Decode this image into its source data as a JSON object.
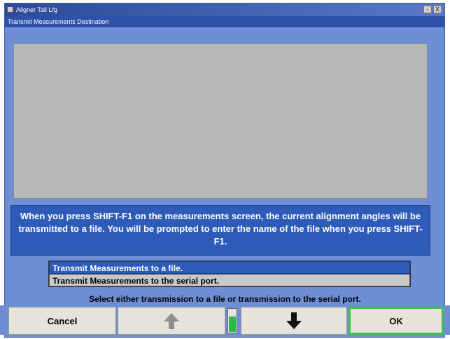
{
  "window": {
    "title": "Aligner Tail Lfg",
    "subtitle": "Transmit Measurements Destination",
    "controls": [
      "-",
      "X"
    ]
  },
  "message": {
    "text": "When you press SHIFT-F1 on the measurements screen, the current alignment angles will be transmitted to a file.  You will be prompted to enter the name of the file when you press SHIFT-F1."
  },
  "list": {
    "items": [
      {
        "label": "Transmit Measurements to a file.",
        "selected": true
      },
      {
        "label": "Transmit Measurements to the serial port.",
        "selected": false
      }
    ]
  },
  "instruction": "Select either transmission to a file or transmission to the serial port.",
  "footer": {
    "cancel_label": "Cancel",
    "up_icon": "arrow-up-icon",
    "down_icon": "arrow-down-icon",
    "ok_label": "OK"
  },
  "colors": {
    "background": "#6E8FD6",
    "message_bg": "#2E5BB8",
    "panel": "#B8B8B8",
    "ok_border": "#3EC24A",
    "indicator": "#2FB54A"
  }
}
